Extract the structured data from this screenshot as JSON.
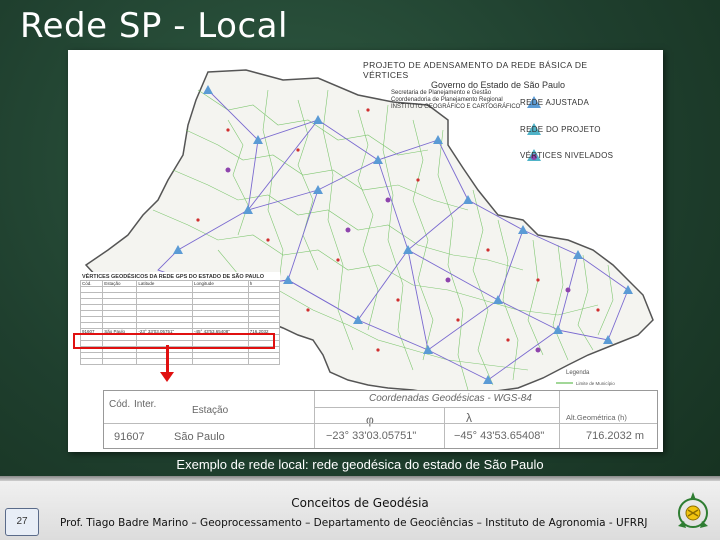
{
  "slide": {
    "title": "Rede SP - Local",
    "caption": "Exemplo de rede local: rede geodésica do estado de São Paulo"
  },
  "figure": {
    "header": {
      "line1": "PROJETO DE ADENSAMENTO DA REDE BÁSICA DE VÉRTICES",
      "line2": "Governo do Estado de São Paulo",
      "line3": "Secretaria de Planejamento e Gestão",
      "line4": "Coordenadoria de Planejamento Regional",
      "line5": "INSTITUTO GEOGRÁFICO E CARTOGRÁFICO"
    },
    "legend": [
      {
        "label": "REDE AJUSTADA",
        "color": "#5b9bd5",
        "icon": "triangle-icon"
      },
      {
        "label": "REDE DO PROJETO",
        "color": "#4fb3c8",
        "icon": "triangle-icon"
      },
      {
        "label": "VÉRTICES NIVELADOS",
        "color": "#8e44ad",
        "icon": "dot-icon"
      }
    ],
    "map_legend": {
      "title": "Legenda",
      "item": "Limite de Município"
    },
    "table": {
      "title": "VÉRTICES GEODÉSICOS DA REDE GPS DO ESTADO DE SÃO PAULO",
      "headers": [
        "Cód.",
        "Estação",
        "Latitude",
        "Longitude",
        "h"
      ],
      "highlighted_row": [
        "91607",
        "São Paulo",
        "-23° 33'03.05751\"",
        "-45° 43'53.65408\"",
        "716.2032"
      ]
    },
    "zoom": {
      "col_cod": "Cód.",
      "col_inter": "Inter.",
      "col_estacao": "Estação",
      "col_coord": "Coordenadas Geodésicas - WGS-84",
      "col_phi": "φ",
      "col_lambda": "λ",
      "col_alt": "Alt.Geométrica (h)",
      "cod": "91607",
      "estacao": "São Paulo",
      "lat": "−23° 33'03.05751\"",
      "lon": "−45° 43'53.65408\"",
      "alt": "716.2032 m"
    }
  },
  "footer": {
    "title": "Conceitos de Geodésia",
    "credit": "Prof. Tiago Badre Marino – Geoprocessamento –  Departamento de Geociências – Instituto de Agronomia - UFRRJ",
    "page_number": "27"
  }
}
